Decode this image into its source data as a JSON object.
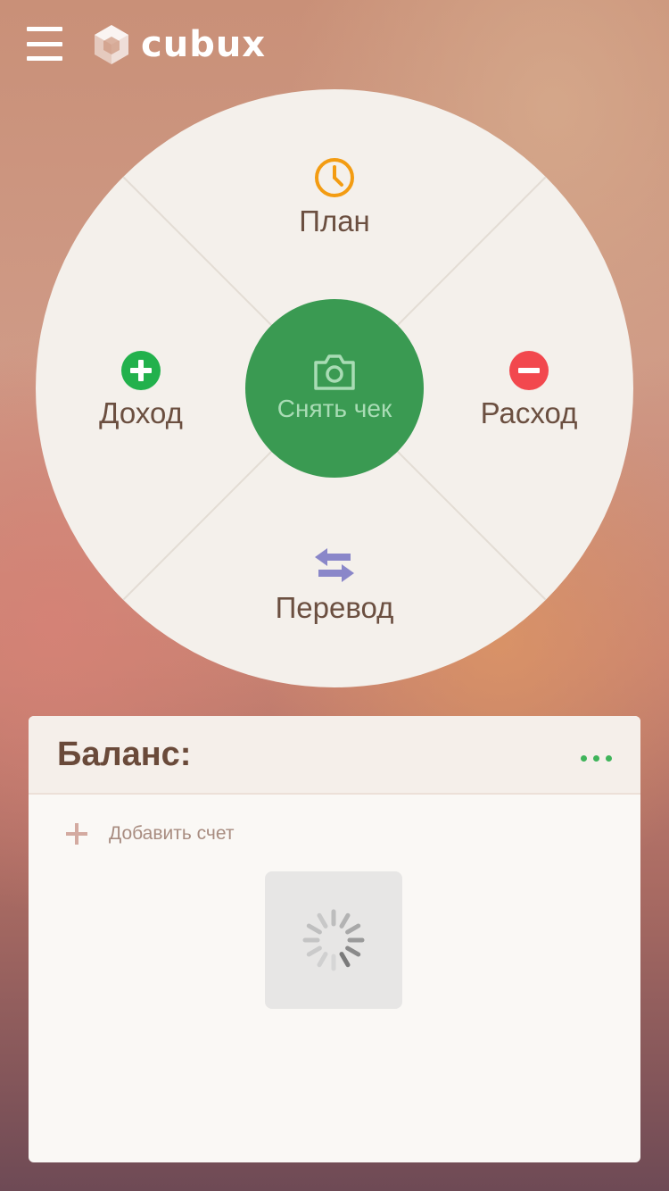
{
  "app": {
    "logo_text": "cubux",
    "menu_icon": "hamburger-icon",
    "logo_icon": "cube-logo-icon"
  },
  "wheel": {
    "plan": {
      "label": "План",
      "icon": "clock-icon",
      "color": "#f39c12"
    },
    "income": {
      "label": "Доход",
      "icon": "plus-circle-icon",
      "color": "#22b14c"
    },
    "expense": {
      "label": "Расход",
      "icon": "minus-circle-icon",
      "color": "#f2484e"
    },
    "transfer": {
      "label": "Перевод",
      "icon": "transfer-arrows-icon",
      "color": "#8a87c9"
    },
    "center": {
      "label": "Снять чек",
      "icon": "camera-icon",
      "color": "#3a9a52"
    }
  },
  "balance_card": {
    "title": "Баланс:",
    "more_icon": "more-dots-icon",
    "add_account_label": "Добавить счет",
    "loading_icon": "spinner-icon"
  }
}
